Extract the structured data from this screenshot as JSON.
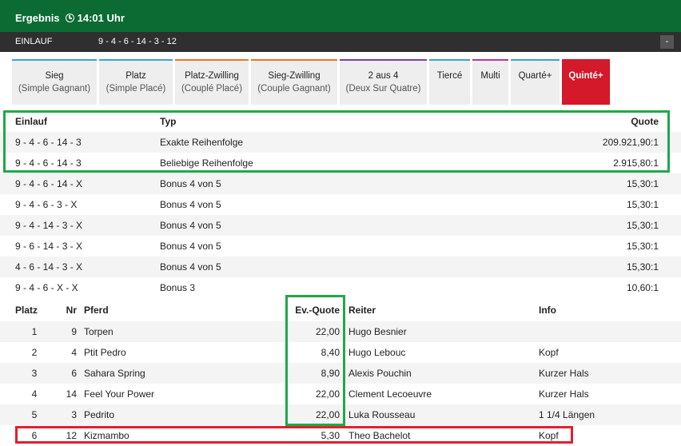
{
  "header": {
    "title": "Ergebnis",
    "time": "14:01 Uhr"
  },
  "einlauf_bar": {
    "label": "EINLAUF",
    "value": "9 - 4 - 6 - 14 - 3 - 12",
    "collapse": "-"
  },
  "tabs": [
    {
      "label": "Sieg",
      "sub": "(Simple Gagnant)",
      "color": "#3aa6c5"
    },
    {
      "label": "Platz",
      "sub": "(Simple Placé)",
      "color": "#3aa6c5"
    },
    {
      "label": "Platz-Zwilling",
      "sub": "(Couplé Placé)",
      "color": "#e07b2b"
    },
    {
      "label": "Sieg-Zwilling",
      "sub": "(Couple Gagnant)",
      "color": "#e07b2b"
    },
    {
      "label": "2 aus 4",
      "sub": "(Deux Sur Quatre)",
      "color": "#7b3ea8"
    },
    {
      "label": "Tiercé",
      "sub": "",
      "color": "#3aa6c5"
    },
    {
      "label": "Multi",
      "sub": "",
      "color": "#b23a9a"
    },
    {
      "label": "Quarté+",
      "sub": "",
      "color": "#3aa6c5"
    },
    {
      "label": "Quinté+",
      "sub": "",
      "color": "#d3192a",
      "active": true
    }
  ],
  "quinte_table": {
    "headers": {
      "einlauf": "Einlauf",
      "typ": "Typ",
      "quote": "Quote"
    },
    "rows": [
      {
        "einlauf": "9 - 4 - 6 - 14 - 3",
        "typ": "Exakte Reihenfolge",
        "quote": "209.921,90:1"
      },
      {
        "einlauf": "9 - 4 - 6 - 14 - 3",
        "typ": "Beliebige Reihenfolge",
        "quote": "2.915,80:1"
      },
      {
        "einlauf": "9 - 4 - 6 - 14 - X",
        "typ": "Bonus 4 von 5",
        "quote": "15,30:1"
      },
      {
        "einlauf": "9 - 4 - 6 - 3 - X",
        "typ": "Bonus 4 von 5",
        "quote": "15,30:1"
      },
      {
        "einlauf": "9 - 4 - 14 - 3 - X",
        "typ": "Bonus 4 von 5",
        "quote": "15,30:1"
      },
      {
        "einlauf": "9 - 6 - 14 - 3 - X",
        "typ": "Bonus 4 von 5",
        "quote": "15,30:1"
      },
      {
        "einlauf": "4 - 6 - 14 - 3 - X",
        "typ": "Bonus 4 von 5",
        "quote": "15,30:1"
      },
      {
        "einlauf": "9 - 4 - 6 - X - X",
        "typ": "Bonus 3",
        "quote": "10,60:1"
      }
    ]
  },
  "results_table": {
    "headers": {
      "platz": "Platz",
      "nr": "Nr",
      "pferd": "Pferd",
      "evq": "Ev.-Quote",
      "reiter": "Reiter",
      "info": "Info"
    },
    "rows": [
      {
        "platz": "1",
        "nr": "9",
        "pferd": "Torpen",
        "evq": "22,00",
        "reiter": "Hugo Besnier",
        "info": ""
      },
      {
        "platz": "2",
        "nr": "4",
        "pferd": "Ptit Pedro",
        "evq": "8,40",
        "reiter": "Hugo Lebouc",
        "info": "Kopf"
      },
      {
        "platz": "3",
        "nr": "6",
        "pferd": "Sahara Spring",
        "evq": "8,90",
        "reiter": "Alexis Pouchin",
        "info": "Kurzer Hals"
      },
      {
        "platz": "4",
        "nr": "14",
        "pferd": "Feel Your Power",
        "evq": "22,00",
        "reiter": "Clement Lecoeuvre",
        "info": "Kurzer Hals"
      },
      {
        "platz": "5",
        "nr": "3",
        "pferd": "Pedrito",
        "evq": "22,00",
        "reiter": "Luka Rousseau",
        "info": "1 1/4 Längen"
      },
      {
        "platz": "6",
        "nr": "12",
        "pferd": "Kizmambo",
        "evq": "5,30",
        "reiter": "Theo Bachelot",
        "info": "Kopf"
      }
    ]
  },
  "colors": {
    "header_green": "#0b6b33",
    "active_tab_red": "#d3192a",
    "highlight_green": "#21a84a",
    "highlight_red": "#e0202e"
  }
}
